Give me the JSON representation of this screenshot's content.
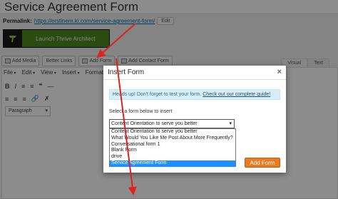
{
  "page": {
    "title": "Service Agreement Form"
  },
  "permalink": {
    "label": "Permalink:",
    "url": "https://erstinem.ki.com/service-agreement-form/",
    "edit_label": "Edit"
  },
  "thrive": {
    "label": "Launch Thrive Architect"
  },
  "media_buttons": {
    "add_media": "Add Media",
    "better_links": "Better Links",
    "add_form": "Add Form",
    "add_contact_form": "Add Contact Form"
  },
  "editor_tabs": {
    "visual": "Visual",
    "text": "Text"
  },
  "menubar": {
    "file": "File",
    "edit": "Edit",
    "view": "View",
    "insert": "Insert",
    "format": "Format"
  },
  "format_select": {
    "value": "Paragraph"
  },
  "modal": {
    "title": "Insert Form",
    "close": "×",
    "notice_text": "Heads up! Don't forget to test your form.",
    "notice_link": "Check out our complete guide!",
    "select_label": "Select a form below to insert",
    "selected_value": "Content Orientation to serve you better",
    "options": [
      "Content Orientation to serve you better",
      "What Would You Like Me Post About More Frequently?",
      "Conversational form 1",
      "Blank Form",
      "drive",
      "Service Agreement Form"
    ],
    "highlighted_index": 5,
    "add_button": "Add Form"
  },
  "colors": {
    "arrow": "#e0211f",
    "highlight": "#1e90ff",
    "add_button": "#e97a1f",
    "thrive_green": "#4f8a1e"
  }
}
